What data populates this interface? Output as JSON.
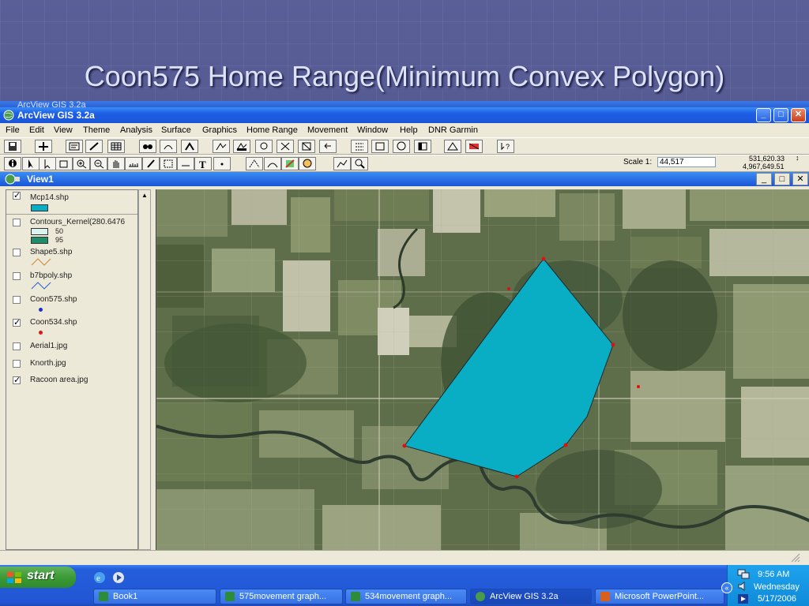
{
  "slide": {
    "title": "Coon575 Home Range(Minimum Convex Polygon)"
  },
  "back_window": {
    "title": "ArcView GIS 3.2a"
  },
  "window": {
    "title": "ArcView GIS 3.2a",
    "min_label": "_",
    "max_label": "□",
    "close_label": "✕"
  },
  "menu": [
    "File",
    "Edit",
    "View",
    "Theme",
    "Analysis",
    "Surface",
    "Graphics",
    "Home Range",
    "Movement",
    "Window",
    "Help",
    "DNR Garmin"
  ],
  "scale": {
    "label": "Scale  1:",
    "value": "44,517"
  },
  "coords": {
    "x": "531,620.33",
    "y": "4,967,649.51",
    "arrows": "↕"
  },
  "view": {
    "title": "View1"
  },
  "toc": {
    "layers": [
      {
        "name": "Mcp14.shp",
        "checked": true,
        "symbol": "fill-cyan"
      },
      {
        "name": "Contours_Kernel(280.6476",
        "checked": false,
        "symbol": "contours",
        "legend": [
          "50",
          "95"
        ]
      },
      {
        "name": "Shape5.shp",
        "checked": false,
        "symbol": "line-orange"
      },
      {
        "name": "b7bpoly.shp",
        "checked": false,
        "symbol": "line-blue"
      },
      {
        "name": "Coon575.shp",
        "checked": false,
        "symbol": "point-blue"
      },
      {
        "name": "Coon534.shp",
        "checked": true,
        "symbol": "point-red"
      },
      {
        "name": "Aerial1.jpg",
        "checked": false,
        "symbol": "none"
      },
      {
        "name": "Knorth.jpg",
        "checked": false,
        "symbol": "none"
      },
      {
        "name": "Racoon area.jpg",
        "checked": true,
        "symbol": "none"
      }
    ]
  },
  "map": {
    "polygon_color": "#0aaec4",
    "vertex_color": "#e01010"
  },
  "taskbar": {
    "start_label": "start",
    "tasks": [
      {
        "label": "Book1",
        "icon_color": "#2e8b3a"
      },
      {
        "label": "575movement graph...",
        "icon_color": "#2e8b3a"
      },
      {
        "label": "534movement graph...",
        "icon_color": "#2e8b3a"
      },
      {
        "label": "ArcView GIS 3.2a",
        "icon_color": "#d0d0d0"
      },
      {
        "label": "Microsoft PowerPoint...",
        "icon_color": "#d8601c"
      }
    ],
    "clock": "9:56 AM",
    "day": "Wednesday",
    "date": "5/17/2006"
  }
}
